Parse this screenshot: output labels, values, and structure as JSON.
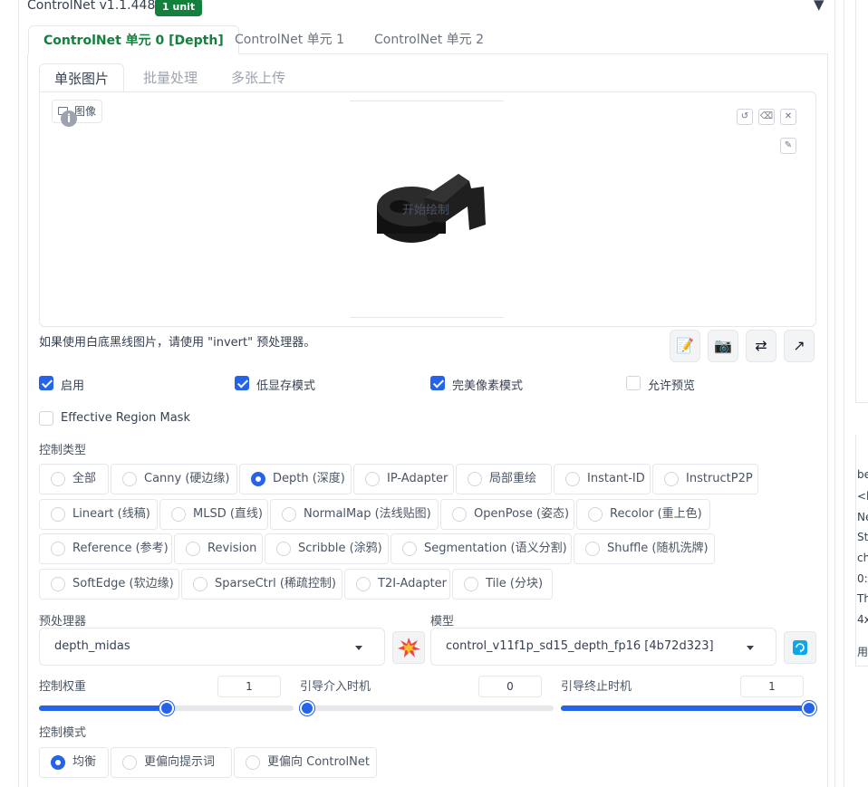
{
  "header": {
    "title": "ControlNet v1.1.448",
    "badge": "1 unit",
    "collapse_icon": "triangle-down"
  },
  "unit_tabs": [
    {
      "label": "ControlNet 单元 0 [Depth]",
      "active": true
    },
    {
      "label": "ControlNet 单元 1",
      "active": false
    },
    {
      "label": "ControlNet 单元 2",
      "active": false
    }
  ],
  "image_tabs": [
    {
      "label": "单张图片",
      "active": true
    },
    {
      "label": "批量处理",
      "active": false
    },
    {
      "label": "多张上传",
      "active": false
    }
  ],
  "canvas": {
    "image_label": "图像",
    "start_draw": "开始绘制",
    "tools": [
      "undo-icon",
      "eraser-icon",
      "close-icon",
      "brush-icon"
    ]
  },
  "invert_hint": "如果使用白底黑线图片，请使用 \"invert\" 预处理器。",
  "action_buttons": [
    "notepad-icon",
    "camera-icon",
    "swap-icon",
    "send-icon"
  ],
  "checkboxes": [
    {
      "label": "启用",
      "checked": true
    },
    {
      "label": "低显存模式",
      "checked": true
    },
    {
      "label": "完美像素模式",
      "checked": true
    },
    {
      "label": "允许预览",
      "checked": false
    },
    {
      "label": "Effective Region Mask",
      "checked": false
    }
  ],
  "control_type": {
    "label": "控制类型",
    "options": [
      "全部",
      "Canny (硬边缘)",
      "Depth (深度)",
      "IP-Adapter",
      "局部重绘",
      "Instant-ID",
      "InstructP2P",
      "Lineart (线稿)",
      "MLSD (直线)",
      "NormalMap (法线贴图)",
      "OpenPose (姿态)",
      "Recolor (重上色)",
      "Reference (参考)",
      "Revision",
      "Scribble (涂鸦)",
      "Segmentation (语义分割)",
      "Shuffle (随机洗牌)",
      "SoftEdge (软边缘)",
      "SparseCtrl (稀疏控制)",
      "T2I-Adapter",
      "Tile (分块)"
    ],
    "selected": "Depth (深度)"
  },
  "preprocessor": {
    "label": "预处理器",
    "value": "depth_midas",
    "run_icon": "explosion-icon"
  },
  "model": {
    "label": "模型",
    "value": "control_v11f1p_sd15_depth_fp16 [4b72d323]",
    "refresh_icon": "refresh-icon"
  },
  "sliders": [
    {
      "label": "控制权重",
      "value": "1",
      "fraction": 0.5
    },
    {
      "label": "引导介入时机",
      "value": "0",
      "fraction": 0.0
    },
    {
      "label": "引导终止时机",
      "value": "1",
      "fraction": 1.0
    }
  ],
  "control_mode": {
    "label": "控制模式",
    "options": [
      "均衡",
      "更偏向提示词",
      "更偏向 ControlNet"
    ],
    "selected": "均衡"
  },
  "side_panel": {
    "lines": [
      "be",
      "<l",
      "Ne",
      "St",
      "ch",
      "0:",
      "Th",
      "4x",
      "用"
    ]
  },
  "colors": {
    "accent": "#2563eb",
    "badge": "#15803d",
    "active_tab": "#15803d"
  }
}
